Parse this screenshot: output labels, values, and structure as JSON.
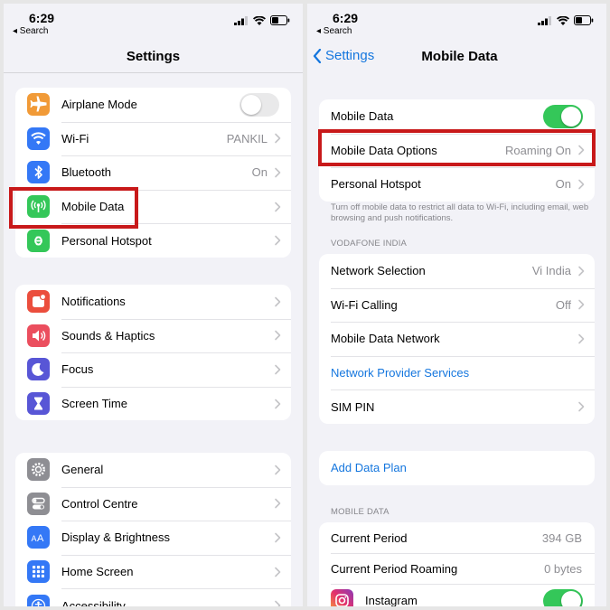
{
  "left": {
    "status": {
      "time": "6:29",
      "back": "◂ Search"
    },
    "title": "Settings",
    "groups": [
      [
        {
          "label": "Airplane Mode",
          "icon": "airplane-icon",
          "color": "#f19a37",
          "toggle": "off"
        },
        {
          "label": "Wi-Fi",
          "value": "PANKIL",
          "icon": "wifi-icon",
          "color": "#3478f6"
        },
        {
          "label": "Bluetooth",
          "value": "On",
          "icon": "bluetooth-icon",
          "color": "#3478f6"
        },
        {
          "label": "Mobile Data",
          "icon": "antenna-icon",
          "color": "#34c759"
        },
        {
          "label": "Personal Hotspot",
          "icon": "hotspot-icon",
          "color": "#34c759"
        }
      ],
      [
        {
          "label": "Notifications",
          "icon": "notifications-icon",
          "color": "#eb4e3d"
        },
        {
          "label": "Sounds & Haptics",
          "icon": "speaker-icon",
          "color": "#eb4e5e"
        },
        {
          "label": "Focus",
          "icon": "moon-icon",
          "color": "#5856d6"
        },
        {
          "label": "Screen Time",
          "icon": "hourglass-icon",
          "color": "#5856d6"
        }
      ],
      [
        {
          "label": "General",
          "icon": "gear-icon",
          "color": "#8e8e93"
        },
        {
          "label": "Control Centre",
          "icon": "switches-icon",
          "color": "#8e8e93"
        },
        {
          "label": "Display & Brightness",
          "icon": "text-size-icon",
          "color": "#3478f6"
        },
        {
          "label": "Home Screen",
          "icon": "app-grid-icon",
          "color": "#3478f6"
        },
        {
          "label": "Accessibility",
          "icon": "accessibility-icon",
          "color": "#3478f6"
        }
      ]
    ]
  },
  "right": {
    "status": {
      "time": "6:29",
      "back": "◂ Search"
    },
    "back_label": "Settings",
    "title": "Mobile Data",
    "group1": [
      {
        "label": "Mobile Data",
        "toggle": "on"
      },
      {
        "label": "Mobile Data Options",
        "value": "Roaming On"
      },
      {
        "label": "Personal Hotspot",
        "value": "On"
      }
    ],
    "footer_note": "Turn off mobile data to restrict all data to Wi-Fi, including email, web browsing and push notifications.",
    "carrier_header": "VODAFONE INDIA",
    "group2": [
      {
        "label": "Network Selection",
        "value": "Vi India"
      },
      {
        "label": "Wi-Fi Calling",
        "value": "Off"
      },
      {
        "label": "Mobile Data Network"
      },
      {
        "label": "Network Provider Services",
        "link": true,
        "nochev": true
      },
      {
        "label": "SIM PIN"
      }
    ],
    "add_plan": "Add Data Plan",
    "usage_header": "MOBILE DATA",
    "usage": [
      {
        "label": "Current Period",
        "value": "394 GB"
      },
      {
        "label": "Current Period Roaming",
        "value": "0 bytes"
      },
      {
        "label": "Instagram",
        "icon": "instagram-icon",
        "toggle": "on"
      }
    ]
  },
  "accent": "#1476de",
  "highlight_color": "#c8191a"
}
